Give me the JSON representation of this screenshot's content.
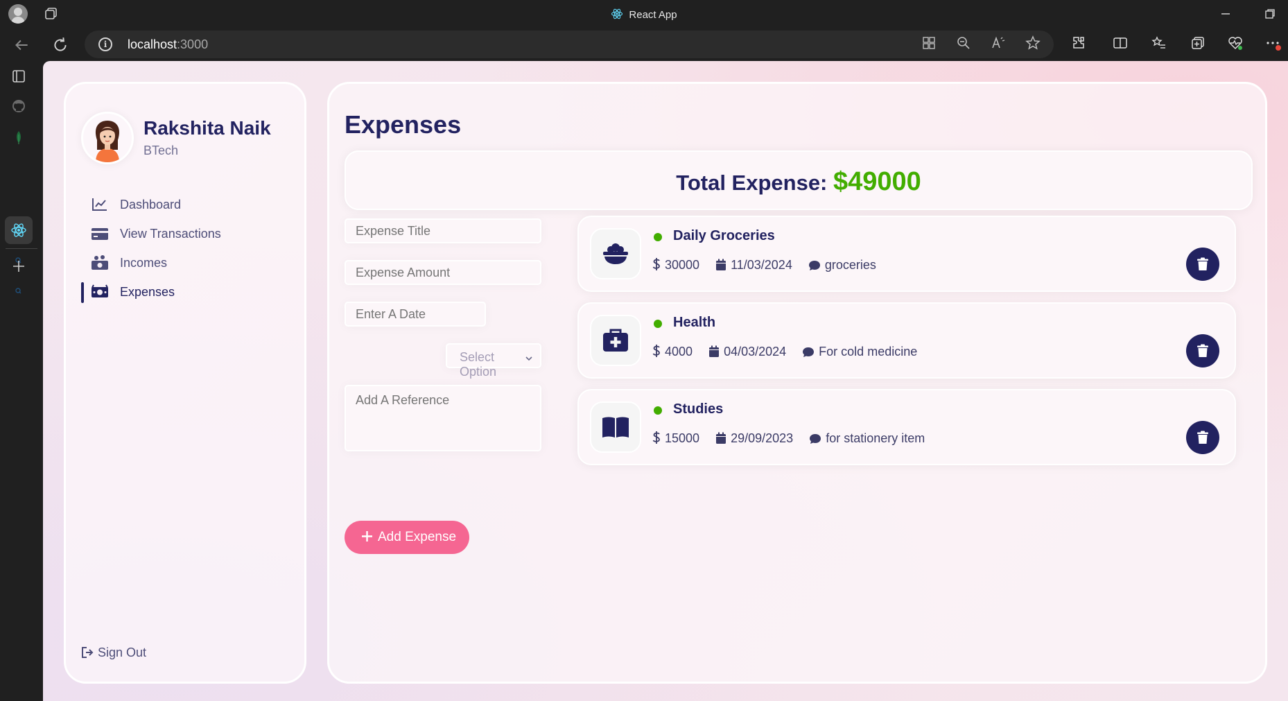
{
  "browser": {
    "tab_title": "React App",
    "url_host": "localhost",
    "url_port": ":3000"
  },
  "user": {
    "name": "Rakshita Naik",
    "title": "BTech"
  },
  "menu": [
    {
      "label": "Dashboard",
      "icon": "chart-line-icon"
    },
    {
      "label": "View Transactions",
      "icon": "credit-card-icon"
    },
    {
      "label": "Incomes",
      "icon": "money-bag-icon"
    },
    {
      "label": "Expenses",
      "icon": "money-bill-icon",
      "active": true
    }
  ],
  "signout": {
    "label": "Sign Out"
  },
  "page": {
    "title": "Expenses",
    "total_label": "Total Expense: ",
    "total_value": "$49000"
  },
  "form": {
    "title_placeholder": "Expense Title",
    "amount_placeholder": "Expense Amount",
    "date_placeholder": "Enter A Date",
    "category_placeholder": "Select Option",
    "reference_placeholder": "Add A Reference",
    "submit_label": "Add Expense"
  },
  "expenses": [
    {
      "title": "Daily Groceries",
      "amount": "30000",
      "date": "11/03/2024",
      "description": "groceries",
      "icon": "bowl-food-icon"
    },
    {
      "title": "Health",
      "amount": "4000",
      "date": "04/03/2024",
      "description": "For cold medicine",
      "icon": "medical-kit-icon"
    },
    {
      "title": "Studies",
      "amount": "15000",
      "date": "29/09/2023",
      "description": "for stationery item",
      "icon": "book-open-icon"
    }
  ],
  "colors": {
    "primary": "#222260",
    "accent": "#f56692",
    "success": "#42ad00"
  }
}
